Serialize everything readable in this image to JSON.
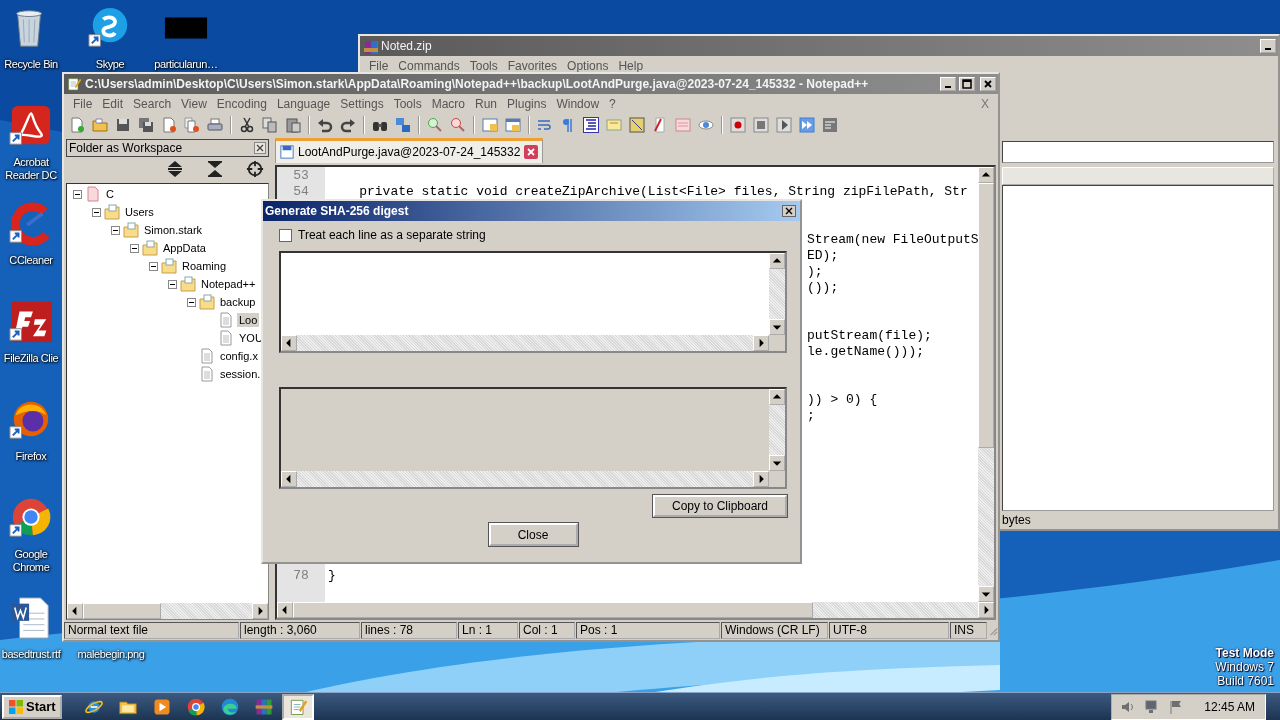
{
  "desktop_icons": [
    {
      "label": "Recycle Bin",
      "kind": "recycle"
    },
    {
      "label": "Skype",
      "kind": "skype"
    },
    {
      "label": "particularun…",
      "kind": "blank"
    },
    {
      "label": "Acrobat Reader DC",
      "kind": "acrobat"
    },
    {
      "label": "CCleaner",
      "kind": "ccleaner"
    },
    {
      "label": "FileZilla Clie",
      "kind": "filezilla"
    },
    {
      "label": "Firefox",
      "kind": "firefox"
    },
    {
      "label": "Google Chrome",
      "kind": "chrome"
    },
    {
      "label": "basedtrust.rtf",
      "kind": "word"
    },
    {
      "label": "malebegin.png",
      "kind": "hidden"
    }
  ],
  "archiver": {
    "title": "Noted.zip",
    "menu": [
      "File",
      "Commands",
      "Tools",
      "Favorites",
      "Options",
      "Help"
    ],
    "status": "bytes"
  },
  "notepad": {
    "title": "C:\\Users\\admin\\Desktop\\C\\Users\\Simon.stark\\AppData\\Roaming\\Notepad++\\backup\\LootAndPurge.java@2023-07-24_145332 - Notepad++",
    "menu": [
      "File",
      "Edit",
      "Search",
      "View",
      "Encoding",
      "Language",
      "Settings",
      "Tools",
      "Macro",
      "Run",
      "Plugins",
      "Window",
      "?"
    ],
    "doc_close": "X",
    "workspace_title": "Folder as Workspace",
    "tree": [
      {
        "label": "C",
        "kind": "drive",
        "expanded": true,
        "selected": false,
        "children": [
          {
            "label": "Users",
            "kind": "folder",
            "expanded": true,
            "selected": false,
            "children": [
              {
                "label": "Simon.stark",
                "kind": "folder",
                "expanded": true,
                "selected": false,
                "children": [
                  {
                    "label": "AppData",
                    "kind": "folder",
                    "expanded": true,
                    "selected": false,
                    "children": [
                      {
                        "label": "Roaming",
                        "kind": "folder",
                        "expanded": true,
                        "selected": false,
                        "children": [
                          {
                            "label": "Notepad++",
                            "kind": "folder",
                            "expanded": true,
                            "selected": false,
                            "children": [
                              {
                                "label": "backup",
                                "kind": "folder",
                                "expanded": true,
                                "selected": false,
                                "children": [
                                  {
                                    "label": "Loo",
                                    "kind": "file",
                                    "selected": true
                                  },
                                  {
                                    "label": "YOU",
                                    "kind": "file",
                                    "selected": false
                                  }
                                ]
                              },
                              {
                                "label": "config.x",
                                "kind": "file",
                                "selected": false
                              },
                              {
                                "label": "session.",
                                "kind": "file",
                                "selected": false
                              }
                            ]
                          }
                        ]
                      }
                    ]
                  }
                ]
              }
            ]
          }
        ]
      }
    ],
    "tabs": [
      {
        "label": "LootAndPurge.java@2023-07-24_145332",
        "selected": true
      }
    ],
    "lines": [
      {
        "kind": "full",
        "num": "53"
      },
      {
        "kind": "full",
        "num": "54",
        "text": "    private static void createZipArchive(List<File> files, String zipFilePath, Str"
      },
      {
        "kind": "blank"
      },
      {
        "kind": "blank"
      },
      {
        "kind": "tail",
        "text": "Stream(new FileOutputS"
      },
      {
        "kind": "tail",
        "text": "ED);"
      },
      {
        "kind": "tail",
        "text": ");"
      },
      {
        "kind": "tail",
        "text": "());"
      },
      {
        "kind": "blank"
      },
      {
        "kind": "blank"
      },
      {
        "kind": "tail",
        "text": "putStream(file);"
      },
      {
        "kind": "tail",
        "text": "le.getName()));"
      },
      {
        "kind": "blank"
      },
      {
        "kind": "blank"
      },
      {
        "kind": "tail",
        "text": ")) > 0) {"
      },
      {
        "kind": "tail",
        "text": ";"
      },
      {
        "kind": "blank"
      },
      {
        "kind": "blank"
      },
      {
        "kind": "blank"
      },
      {
        "kind": "blank"
      },
      {
        "kind": "blank"
      },
      {
        "kind": "blank"
      },
      {
        "kind": "blank"
      },
      {
        "kind": "blank"
      },
      {
        "kind": "blank"
      },
      {
        "kind": "full",
        "num": "78",
        "text": "}"
      }
    ],
    "status": [
      "Normal text file",
      "length : 3,060",
      "lines : 78",
      "Ln : 1",
      "Col : 1",
      "Pos : 1",
      "Windows (CR LF)",
      "UTF-8",
      "INS"
    ]
  },
  "dialog": {
    "title": "Generate SHA-256 digest",
    "checkbox": {
      "label": "Treat each line as a separate string",
      "checked": false
    },
    "copy_button": "Copy to Clipboard",
    "close_button": "Close"
  },
  "os_watermark": [
    "Test Mode",
    "Windows 7",
    "Build 7601"
  ],
  "taskbar": {
    "start": "Start",
    "apps": [
      {
        "kind": "ie",
        "selected": false
      },
      {
        "kind": "explorer",
        "selected": false
      },
      {
        "kind": "media",
        "selected": false
      },
      {
        "kind": "chrome",
        "selected": false
      },
      {
        "kind": "edge",
        "selected": false
      },
      {
        "kind": "winrar",
        "selected": false
      },
      {
        "kind": "notepad",
        "selected": true
      }
    ],
    "clock": "12:45 AM"
  }
}
